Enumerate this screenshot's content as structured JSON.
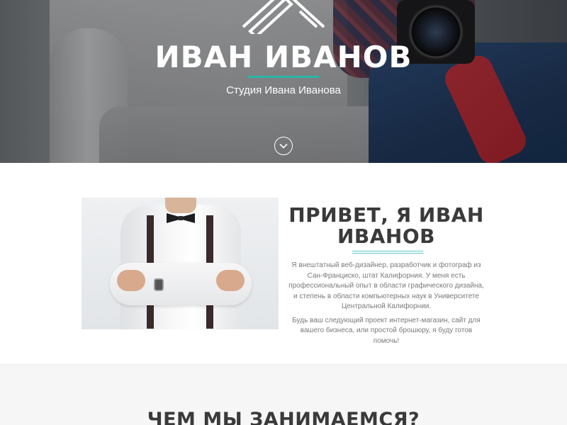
{
  "hero": {
    "logo_icon": "pencil-chevron-logo-icon",
    "title": "ИВАН ИВАНОВ",
    "subtitle": "Студия Ивана Иванова",
    "scroll_icon": "chevron-down-icon",
    "accent_color": "#29b6a6"
  },
  "about": {
    "photo": "man-with-bowtie-photo",
    "title": "ПРИВЕТ, Я ИВАН ИВАНОВ",
    "paragraphs": [
      "Я внештатный веб-дизайнер, разработчик и фотограф из Сан-Франциско, штат Калифорния. У меня есть профессиональный опыт в области графического дизайна, и степень в области компьютерных наук в Университете Центральной Калифорнии.",
      "Будь ваш следующий проект интернет-магазин, сайт для вашего бизнеса, или простой брошюру, я буду готов помочь!"
    ]
  },
  "services": {
    "title": "ЧЕМ МЫ ЗАНИМАЕМСЯ?"
  }
}
